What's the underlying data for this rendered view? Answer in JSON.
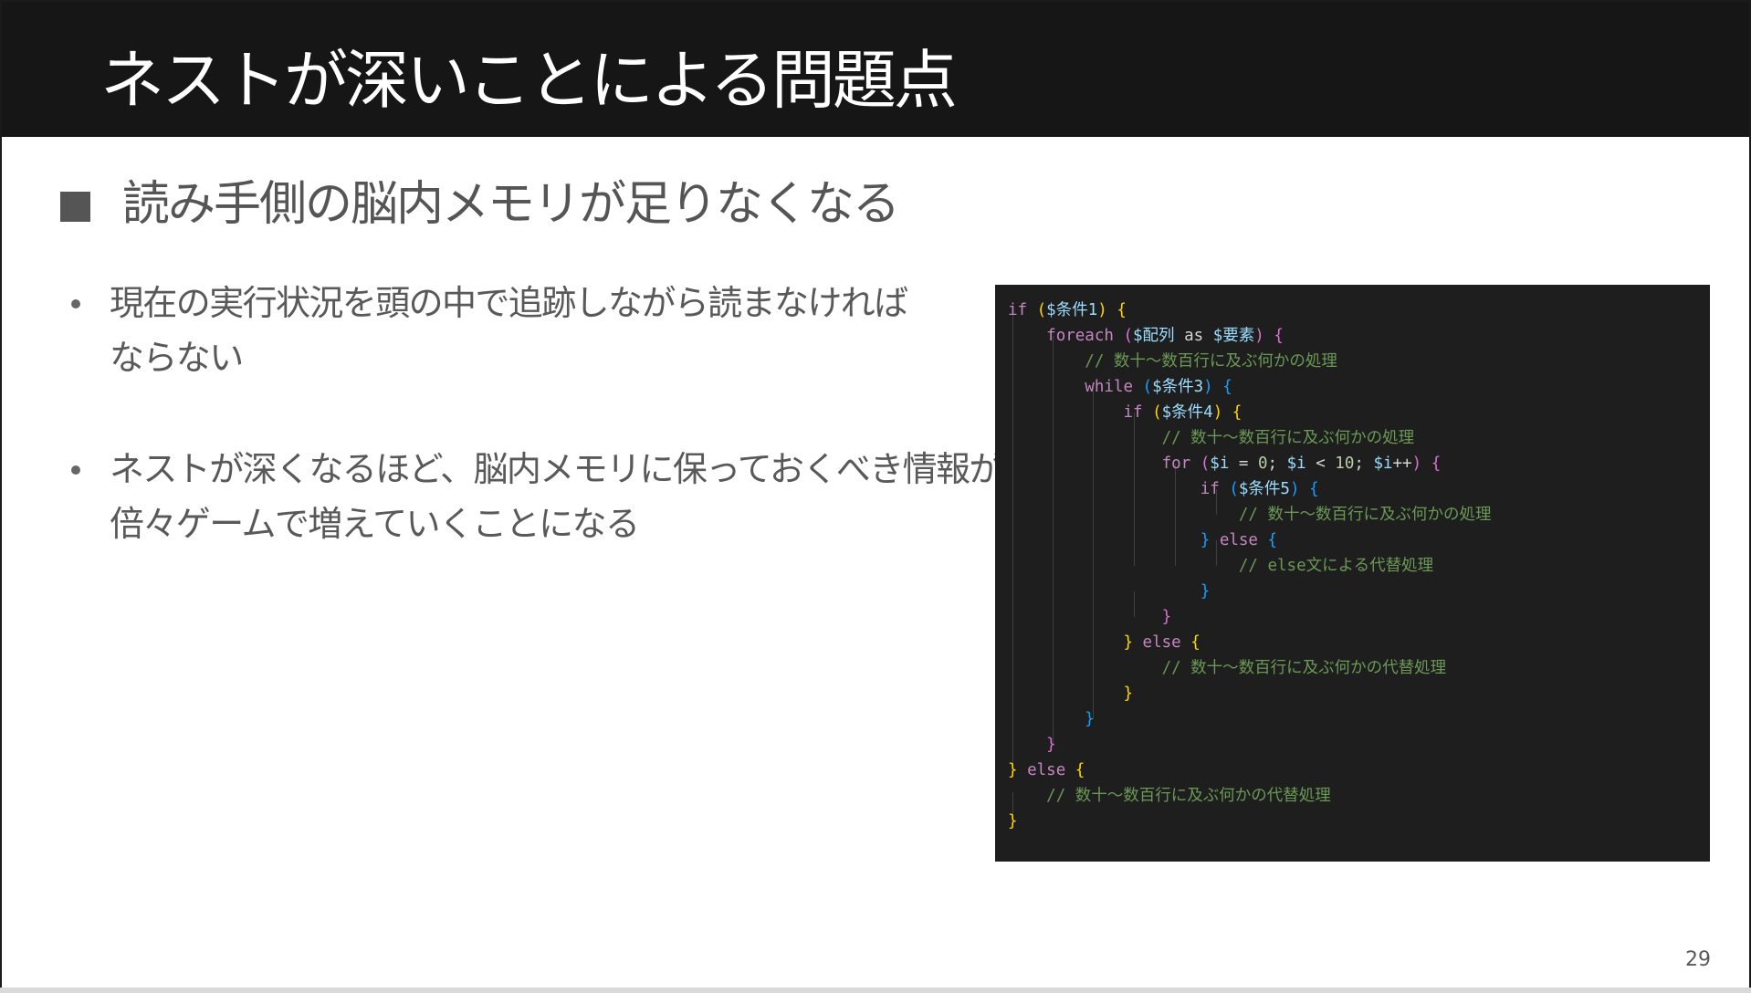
{
  "slide": {
    "title": "ネストが深いことによる問題点",
    "section_heading": "読み手側の脳内メモリが足りなくなる",
    "bullets": [
      {
        "lines": [
          "現在の実行状況を頭の中で追跡しながら読まなければ",
          "ならない"
        ]
      },
      {
        "lines": [
          "ネストが深くなるほど、脳内メモリに保っておくべき情報が",
          "倍々ゲームで増えていくことになる"
        ]
      }
    ],
    "page_number": "29"
  },
  "code": {
    "kw_if": "if",
    "kw_foreach": "foreach",
    "kw_as": "as",
    "kw_while": "while",
    "kw_for": "for",
    "kw_else": "else",
    "var_cond1": "$条件1",
    "var_array": "$配列",
    "var_elem": "$要素",
    "var_cond3": "$条件3",
    "var_cond4": "$条件4",
    "var_cond5": "$条件5",
    "var_i": "$i",
    "num_0": "0",
    "num_10": "10",
    "comment_process": "// 数十～数百行に及ぶ何かの処理",
    "comment_else": "// else文による代替処理",
    "comment_alt": "// 数十～数百行に及ぶ何かの代替処理"
  },
  "colors": {
    "title_bar": "#161616",
    "code_background": "#1e1e1e",
    "bracket_level1": "#ffd700",
    "bracket_level2": "#da70d6",
    "bracket_level3": "#179fff",
    "comment": "#6a9955",
    "variable": "#9cdcfe",
    "keyword": "#c586c0"
  }
}
